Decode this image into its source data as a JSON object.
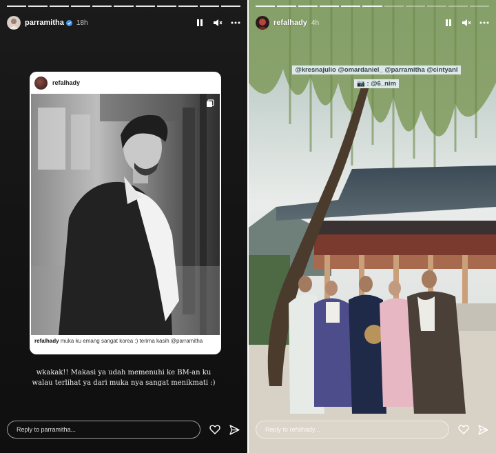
{
  "left_story": {
    "progress_segments": 11,
    "progress_done": 11,
    "username": "parramitha",
    "time": "18h",
    "post": {
      "username": "refalhady",
      "caption_user": "refalhady",
      "caption_text": "muka ku emang sangat korea :) terima kasih @parramitha"
    },
    "story_text_line1": "wkakak!! Makasi ya udah memenuhi ke BM-an ku",
    "story_text_line2": "walau terlihat ya dari muka nya sangat menikmati :)",
    "reply_placeholder": "Reply to parramitha..."
  },
  "right_story": {
    "progress_segments": 11,
    "progress_done": 6,
    "username": "refalhady",
    "time": "4h",
    "tags_line1": "@kresnajulio @omardaniel_ @parramitha @cintyanl",
    "tags_line2": "📷 : @6_nim",
    "reply_placeholder": "Reply to refalhady..."
  },
  "icons": [
    "verified-badge-icon",
    "pause-icon",
    "mute-icon",
    "more-icon",
    "heart-icon",
    "send-icon",
    "multiple-images-icon"
  ],
  "colors": {
    "verified": "#3897f0",
    "tag_bg": "#dfe8e8",
    "tag_text": "#2f4648"
  }
}
